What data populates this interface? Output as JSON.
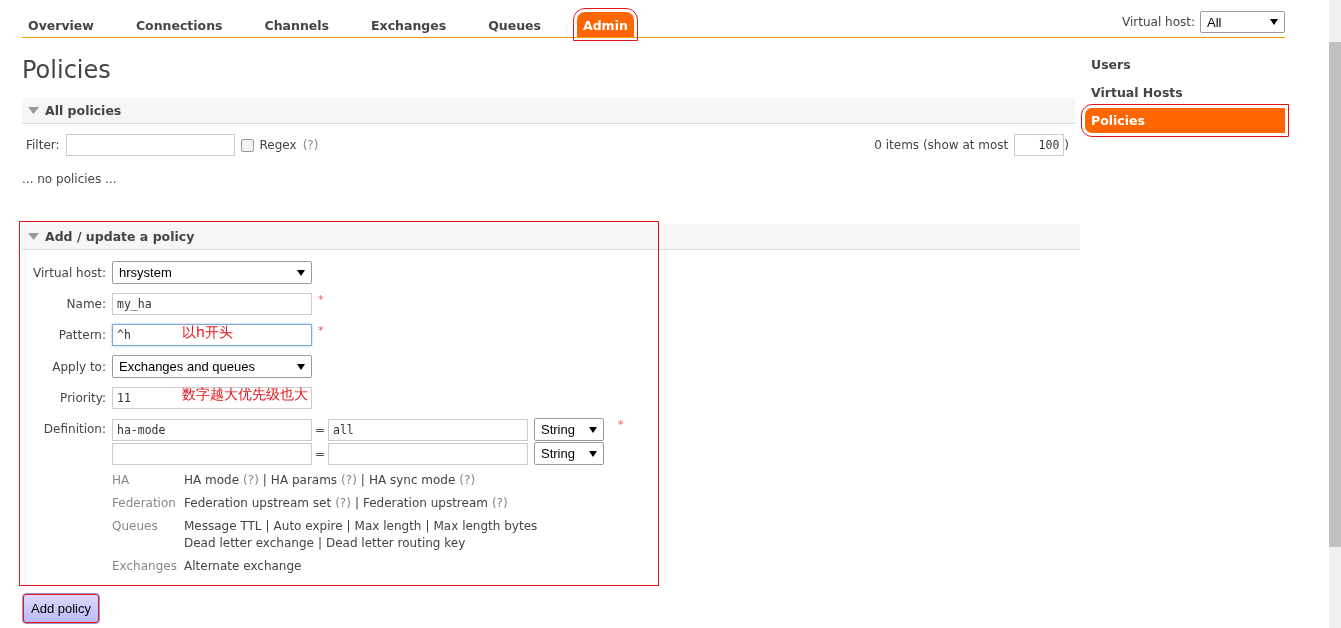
{
  "tabs": [
    {
      "label": "Overview",
      "selected": false,
      "highlighted": false
    },
    {
      "label": "Connections",
      "selected": false,
      "highlighted": false
    },
    {
      "label": "Channels",
      "selected": false,
      "highlighted": false
    },
    {
      "label": "Exchanges",
      "selected": false,
      "highlighted": false
    },
    {
      "label": "Queues",
      "selected": false,
      "highlighted": false
    },
    {
      "label": "Admin",
      "selected": true,
      "highlighted": true
    }
  ],
  "vhost_picker": {
    "label": "Virtual host:",
    "value": "All"
  },
  "title": "Policies",
  "sidebar": {
    "items": [
      {
        "label": "Users",
        "selected": false,
        "highlighted": false
      },
      {
        "label": "Virtual Hosts",
        "selected": false,
        "highlighted": false
      },
      {
        "label": "Policies",
        "selected": true,
        "highlighted": true
      }
    ]
  },
  "all_policies": {
    "heading": "All policies",
    "expanded": true,
    "filter_label": "Filter:",
    "regex": {
      "label": "Regex",
      "checked": false,
      "help": "(?)"
    },
    "count_text": "0 items (show at most",
    "page_size": "100",
    "count_close": ")",
    "empty_text": "... no policies ..."
  },
  "form": {
    "heading": "Add / update a policy",
    "expanded": true,
    "highlighted": true,
    "fields": [
      {
        "kind": "select",
        "label": "Virtual host:",
        "value": "hrsystem"
      },
      {
        "kind": "text",
        "label": "Name:",
        "value": "my_ha",
        "required_mark": "*",
        "focused": false
      },
      {
        "kind": "text",
        "label": "Pattern:",
        "value": "^h",
        "required_mark": "*",
        "focused": true,
        "note": "以h开头"
      },
      {
        "kind": "select",
        "label": "Apply to:",
        "value": "Exchanges and queues"
      },
      {
        "kind": "text",
        "label": "Priority:",
        "value": "11",
        "focused": false,
        "note": "数字越大优先级也大"
      }
    ],
    "definition": {
      "label": "Definition:",
      "required_mark": "*",
      "rows": [
        {
          "key": "ha-mode",
          "equals": "=",
          "value": "all",
          "type": "String"
        },
        {
          "key": "",
          "equals": "=",
          "value": "",
          "type": "String"
        }
      ]
    },
    "hints": [
      {
        "group": "HA",
        "lines": [
          [
            {
              "text": "HA mode",
              "help": "(?)",
              "separator": "|"
            },
            {
              "text": "HA params",
              "help": "(?)",
              "separator": "|"
            },
            {
              "text": "HA sync mode",
              "help": "(?)"
            }
          ]
        ]
      },
      {
        "group": "Federation",
        "lines": [
          [
            {
              "text": "Federation upstream set",
              "help": "(?)",
              "separator": "|"
            },
            {
              "text": "Federation upstream",
              "help": "(?)"
            }
          ]
        ]
      },
      {
        "group": "Queues",
        "lines": [
          [
            {
              "text": "Message TTL",
              "separator": "|"
            },
            {
              "text": "Auto expire",
              "separator": "|"
            },
            {
              "text": "Max length",
              "separator": "|"
            },
            {
              "text": "Max length bytes"
            }
          ],
          [
            {
              "text": "Dead letter exchange",
              "separator": "|"
            },
            {
              "text": "Dead letter routing key"
            }
          ]
        ]
      },
      {
        "group": "Exchanges",
        "lines": [
          [
            {
              "text": "Alternate exchange"
            }
          ]
        ]
      }
    ],
    "submit": {
      "label": "Add policy",
      "highlighted": true
    }
  }
}
